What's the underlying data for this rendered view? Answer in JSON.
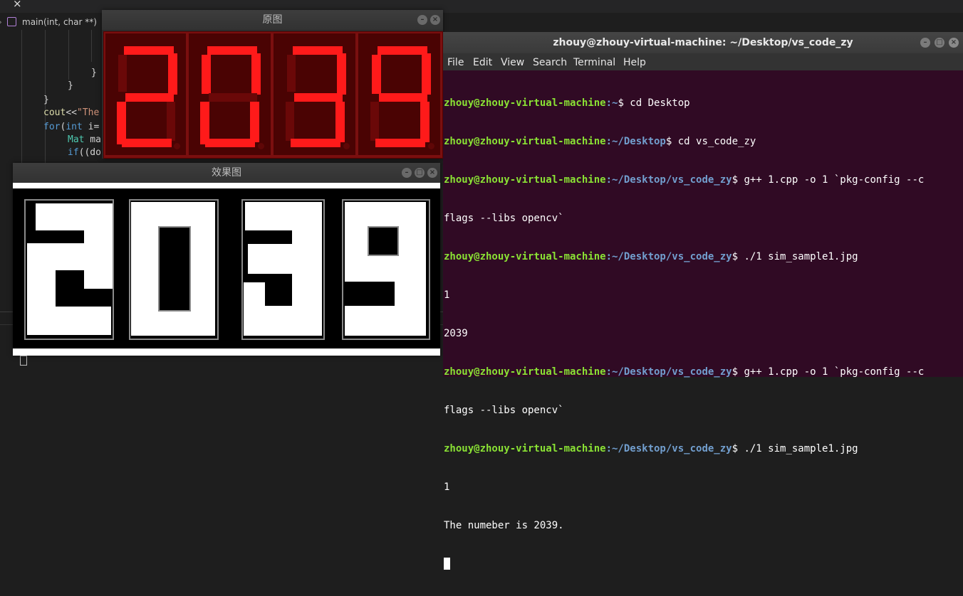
{
  "vscode": {
    "tab_close": "×",
    "breadcrumb": "main(int, char **)",
    "code_lines": [
      {
        "indent": "        ",
        "text": "}"
      },
      {
        "indent": "      ",
        "text": "}"
      },
      {
        "indent": "  ",
        "text": "}"
      },
      {
        "indent": "  ",
        "text": "cout<<\"The"
      },
      {
        "indent": "  ",
        "text": "for(int i="
      },
      {
        "indent": "      ",
        "text": "Mat ma"
      },
      {
        "indent": "      ",
        "text": "if((do"
      }
    ],
    "panel_cursor": "▯"
  },
  "orig_window": {
    "title": "原图",
    "digits": "2039",
    "segment_color": "#ff1a1a",
    "background_color": "#7a0f0f"
  },
  "result_window": {
    "title": "效果图",
    "digits": "2039"
  },
  "window_buttons": {
    "minimize": "–",
    "maximize": "□",
    "close": "×"
  },
  "terminal": {
    "title": "zhouy@zhouy-virtual-machine: ~/Desktop/vs_code_zy",
    "menu": [
      "File",
      "Edit",
      "View",
      "Search",
      "Terminal",
      "Help"
    ],
    "lines": [
      {
        "user": "zhouy@zhouy-virtual-machine",
        "path": ":~",
        "cmd": "$ cd Desktop"
      },
      {
        "user": "zhouy@zhouy-virtual-machine",
        "path": ":~/Desktop",
        "cmd": "$ cd vs_code_zy"
      },
      {
        "user": "zhouy@zhouy-virtual-machine",
        "path": ":~/Desktop/vs_code_zy",
        "cmd": "$ g++ 1.cpp -o 1 `pkg-config --c"
      },
      {
        "user": "",
        "path": "",
        "cmd": "flags --libs opencv`"
      },
      {
        "user": "zhouy@zhouy-virtual-machine",
        "path": ":~/Desktop/vs_code_zy",
        "cmd": "$ ./1 sim_sample1.jpg"
      },
      {
        "user": "",
        "path": "",
        "cmd": "1"
      },
      {
        "user": "",
        "path": "",
        "cmd": "2039"
      },
      {
        "user": "zhouy@zhouy-virtual-machine",
        "path": ":~/Desktop/vs_code_zy",
        "cmd": "$ g++ 1.cpp -o 1 `pkg-config --c"
      },
      {
        "user": "",
        "path": "",
        "cmd": "flags --libs opencv`"
      },
      {
        "user": "zhouy@zhouy-virtual-machine",
        "path": ":~/Desktop/vs_code_zy",
        "cmd": "$ ./1 sim_sample1.jpg"
      },
      {
        "user": "",
        "path": "",
        "cmd": "1"
      },
      {
        "user": "",
        "path": "",
        "cmd": "The numeber is 2039."
      }
    ]
  }
}
